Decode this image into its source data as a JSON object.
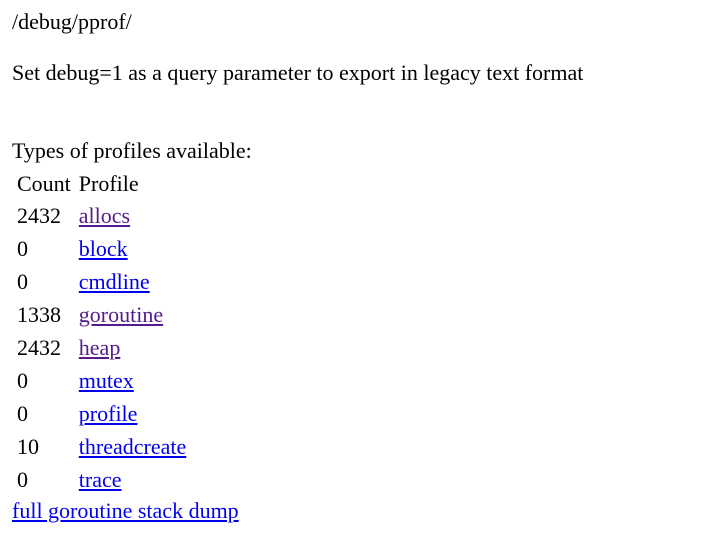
{
  "page": {
    "path": "/debug/pprof/",
    "hint": "Set debug=1 as a query parameter to export in legacy text format",
    "types_heading": "Types of profiles available:"
  },
  "table": {
    "headers": {
      "count": "Count",
      "profile": "Profile"
    },
    "rows": [
      {
        "count": "2432",
        "profile": "allocs",
        "visited": true
      },
      {
        "count": "0",
        "profile": "block",
        "visited": false
      },
      {
        "count": "0",
        "profile": "cmdline",
        "visited": false
      },
      {
        "count": "1338",
        "profile": "goroutine",
        "visited": true
      },
      {
        "count": "2432",
        "profile": "heap",
        "visited": true
      },
      {
        "count": "0",
        "profile": "mutex",
        "visited": false
      },
      {
        "count": "0",
        "profile": "profile",
        "visited": false
      },
      {
        "count": "10",
        "profile": "threadcreate",
        "visited": false
      },
      {
        "count": "0",
        "profile": "trace",
        "visited": false
      }
    ]
  },
  "footer": {
    "dump_link": "full goroutine stack dump"
  },
  "colors": {
    "link": "#0000ee",
    "visited_link": "#551a8b",
    "text": "#000000",
    "background": "#ffffff"
  }
}
